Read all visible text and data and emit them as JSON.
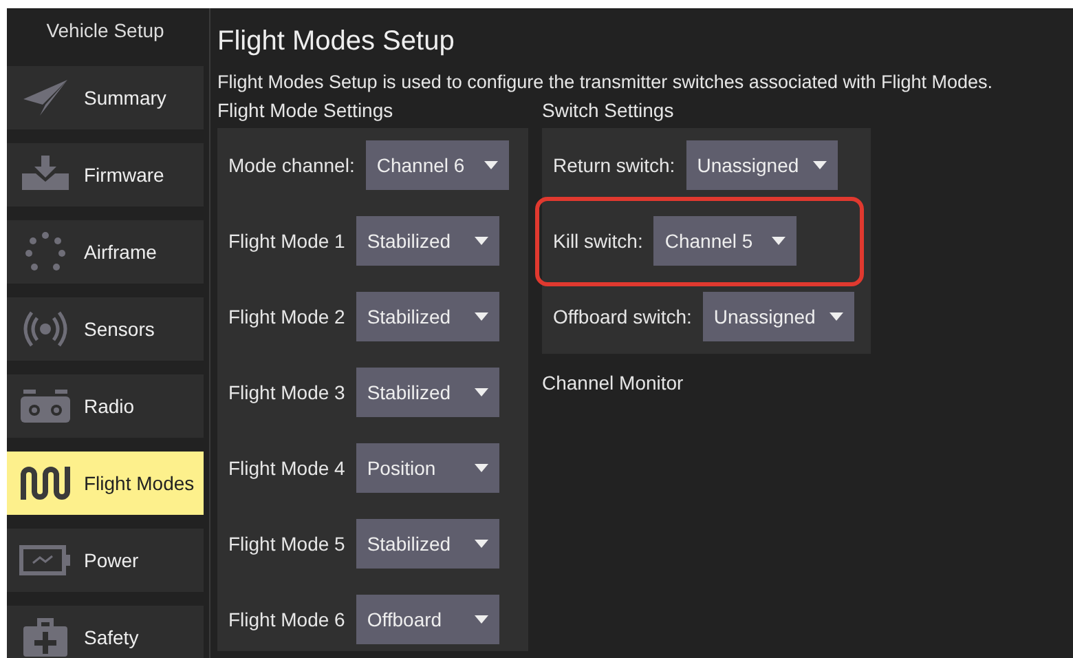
{
  "sidebar": {
    "title": "Vehicle Setup",
    "items": [
      {
        "label": "Summary",
        "selected": false
      },
      {
        "label": "Firmware",
        "selected": false
      },
      {
        "label": "Airframe",
        "selected": false
      },
      {
        "label": "Sensors",
        "selected": false
      },
      {
        "label": "Radio",
        "selected": false
      },
      {
        "label": "Flight Modes",
        "selected": true
      },
      {
        "label": "Power",
        "selected": false
      },
      {
        "label": "Safety",
        "selected": false
      }
    ]
  },
  "page": {
    "title": "Flight Modes Setup",
    "description": "Flight Modes Setup is used to configure the transmitter switches associated with Flight Modes."
  },
  "flight_mode_settings": {
    "heading": "Flight Mode Settings",
    "rows": [
      {
        "label": "Mode channel:",
        "value": "Channel 6"
      },
      {
        "label": "Flight Mode 1",
        "value": "Stabilized"
      },
      {
        "label": "Flight Mode 2",
        "value": "Stabilized"
      },
      {
        "label": "Flight Mode 3",
        "value": "Stabilized"
      },
      {
        "label": "Flight Mode 4",
        "value": "Position"
      },
      {
        "label": "Flight Mode 5",
        "value": "Stabilized"
      },
      {
        "label": "Flight Mode 6",
        "value": "Offboard"
      }
    ]
  },
  "switch_settings": {
    "heading": "Switch Settings",
    "rows": [
      {
        "label": "Return switch:",
        "value": "Unassigned",
        "highlighted": false
      },
      {
        "label": "Kill switch:",
        "value": "Channel 5",
        "highlighted": true
      },
      {
        "label": "Offboard switch:",
        "value": "Unassigned",
        "highlighted": false
      }
    ]
  },
  "channel_monitor": {
    "heading": "Channel Monitor"
  }
}
